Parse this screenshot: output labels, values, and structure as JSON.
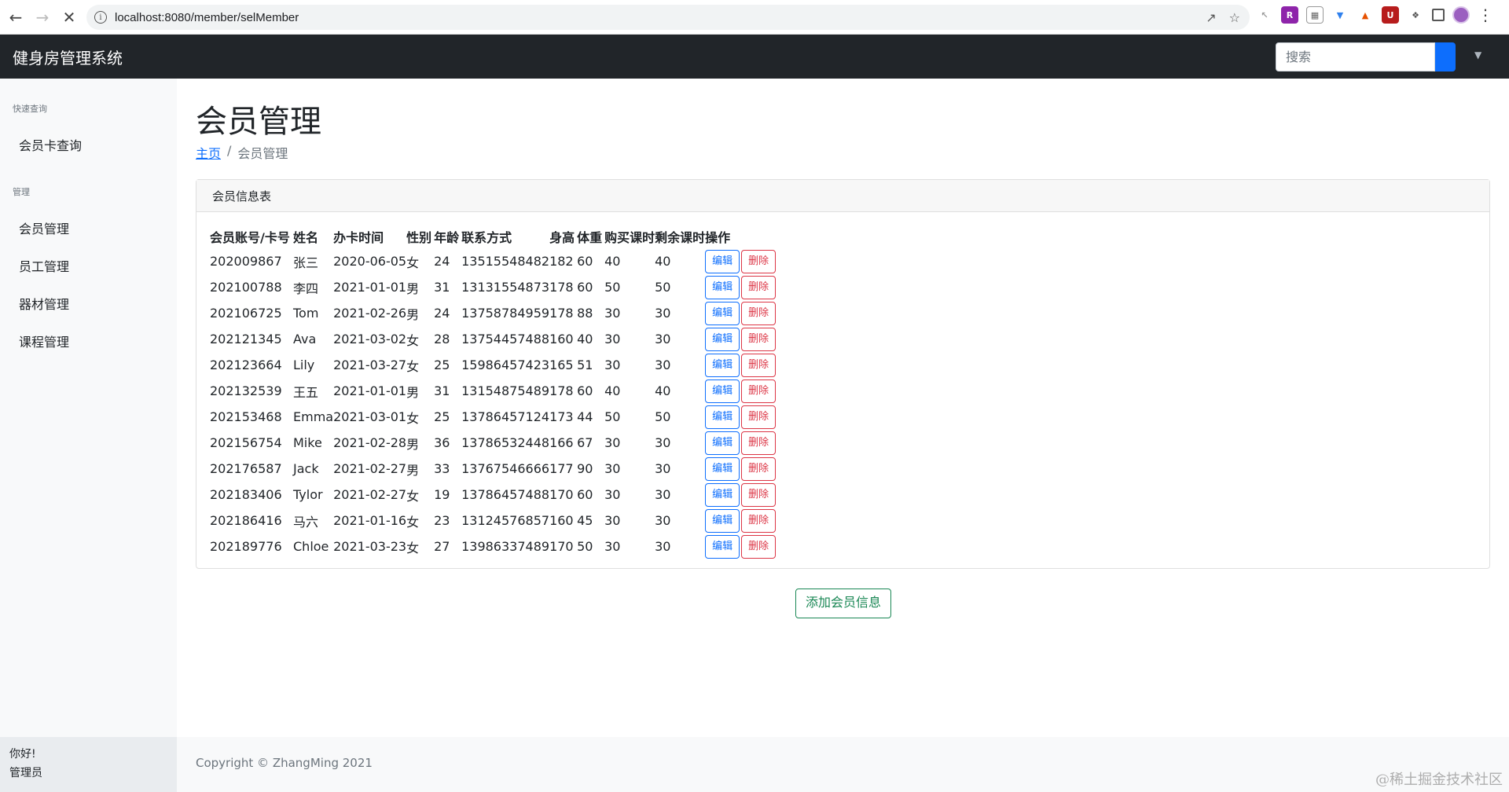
{
  "browser": {
    "url": "localhost:8080/member/selMember"
  },
  "navbar": {
    "brand": "健身房管理系统",
    "search_placeholder": "搜索"
  },
  "sidebar": {
    "section_quick": "快速查询",
    "item_card_query": "会员卡查询",
    "section_manage": "管理",
    "items": [
      "会员管理",
      "员工管理",
      "器材管理",
      "课程管理"
    ],
    "footer_greeting": "你好!",
    "footer_user": "管理员"
  },
  "main": {
    "title": "会员管理",
    "breadcrumb_home": "主页",
    "breadcrumb_sep": "/",
    "breadcrumb_current": "会员管理",
    "card_title": "会员信息表",
    "columns": [
      "会员账号/卡号",
      "姓名",
      "办卡时间",
      "性别",
      "年龄",
      "联系方式",
      "身高",
      "体重",
      "购买课时",
      "剩余课时",
      "操作"
    ],
    "rows": [
      [
        "202009867",
        "张三",
        "2020-06-05",
        "女",
        "24",
        "13515548482",
        "182",
        "60",
        "40",
        "40"
      ],
      [
        "202100788",
        "李四",
        "2021-01-01",
        "男",
        "31",
        "13131554873",
        "178",
        "60",
        "50",
        "50"
      ],
      [
        "202106725",
        "Tom",
        "2021-02-26",
        "男",
        "24",
        "13758784959",
        "178",
        "88",
        "30",
        "30"
      ],
      [
        "202121345",
        "Ava",
        "2021-03-02",
        "女",
        "28",
        "13754457488",
        "160",
        "40",
        "30",
        "30"
      ],
      [
        "202123664",
        "Lily",
        "2021-03-27",
        "女",
        "25",
        "15986457423",
        "165",
        "51",
        "30",
        "30"
      ],
      [
        "202132539",
        "王五",
        "2021-01-01",
        "男",
        "31",
        "13154875489",
        "178",
        "60",
        "40",
        "40"
      ],
      [
        "202153468",
        "Emma",
        "2021-03-01",
        "女",
        "25",
        "13786457124",
        "173",
        "44",
        "50",
        "50"
      ],
      [
        "202156754",
        "Mike",
        "2021-02-28",
        "男",
        "36",
        "13786532448",
        "166",
        "67",
        "30",
        "30"
      ],
      [
        "202176587",
        "Jack",
        "2021-02-27",
        "男",
        "33",
        "13767546666",
        "177",
        "90",
        "30",
        "30"
      ],
      [
        "202183406",
        "Tylor",
        "2021-02-27",
        "女",
        "19",
        "13786457488",
        "170",
        "60",
        "30",
        "30"
      ],
      [
        "202186416",
        "马六",
        "2021-01-16",
        "女",
        "23",
        "13124576857",
        "160",
        "45",
        "30",
        "30"
      ],
      [
        "202189776",
        "Chloe",
        "2021-03-23",
        "女",
        "27",
        "13986337489",
        "170",
        "50",
        "30",
        "30"
      ]
    ],
    "edit_label": "编辑",
    "delete_label": "删除",
    "add_label": "添加会员信息"
  },
  "footer": {
    "copyright": "Copyright © ZhangMing 2021"
  },
  "watermark": "@稀土掘金技术社区"
}
